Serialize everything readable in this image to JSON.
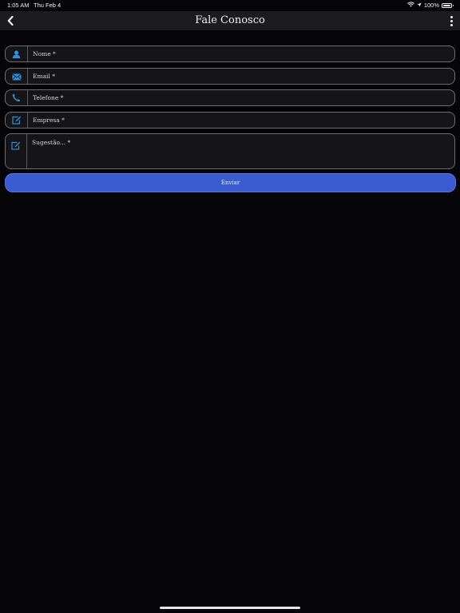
{
  "status": {
    "time": "1:05 AM",
    "date": "Thu Feb 4",
    "battery": "100%"
  },
  "header": {
    "title": "Fale Conosco"
  },
  "form": {
    "fields": [
      {
        "name": "nome",
        "placeholder": "Nome *",
        "icon": "person-icon"
      },
      {
        "name": "email",
        "placeholder": "Email *",
        "icon": "envelope-icon"
      },
      {
        "name": "telefone",
        "placeholder": "Telefone *",
        "icon": "phone-icon"
      },
      {
        "name": "empresa",
        "placeholder": "Empresa *",
        "icon": "edit-icon"
      },
      {
        "name": "sugestao",
        "placeholder": "Sugestão... *",
        "icon": "edit-icon"
      }
    ],
    "submit_label": "Enviar"
  },
  "colors": {
    "background": "#050507",
    "nav_bar": "#1c1c1f",
    "icon_accent": "#2f8fd8",
    "submit_button": "#3b5bd0"
  }
}
